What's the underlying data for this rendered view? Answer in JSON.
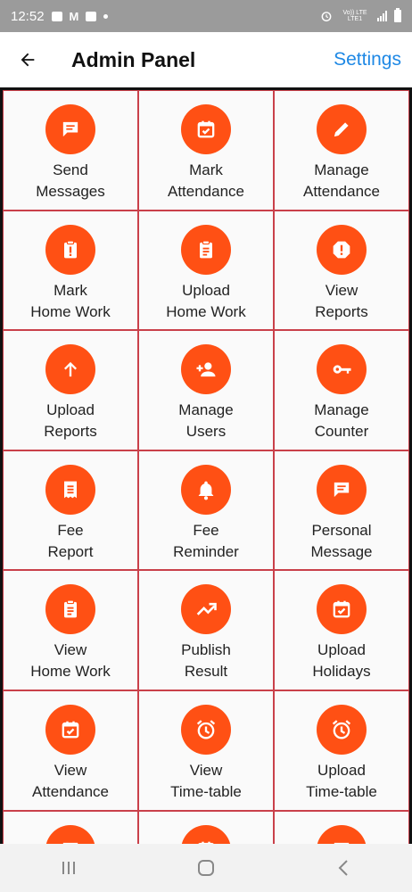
{
  "status_bar": {
    "time": "12:52",
    "network": "Vo)) LTE LTE1"
  },
  "app_bar": {
    "title": "Admin Panel",
    "settings_label": "Settings"
  },
  "colors": {
    "accent": "#ff5014",
    "tile_border": "#c9404a",
    "link": "#1e88e5"
  },
  "tiles": [
    {
      "line1": "Send",
      "line2": "Messages",
      "icon": "message-icon"
    },
    {
      "line1": "Mark",
      "line2": "Attendance",
      "icon": "calendar-check-icon"
    },
    {
      "line1": "Manage",
      "line2": "Attendance",
      "icon": "pencil-icon"
    },
    {
      "line1": "Mark",
      "line2": "Home Work",
      "icon": "clipboard-alert-icon"
    },
    {
      "line1": "Upload",
      "line2": "Home Work",
      "icon": "clipboard-list-icon"
    },
    {
      "line1": "View",
      "line2": "Reports",
      "icon": "report-alert-icon"
    },
    {
      "line1": "Upload",
      "line2": "Reports",
      "icon": "arrow-up-icon"
    },
    {
      "line1": "Manage",
      "line2": "Users",
      "icon": "add-user-icon"
    },
    {
      "line1": "Manage",
      "line2": "Counter",
      "icon": "key-icon"
    },
    {
      "line1": "Fee",
      "line2": "Report",
      "icon": "receipt-icon"
    },
    {
      "line1": "Fee",
      "line2": "Reminder",
      "icon": "bell-icon"
    },
    {
      "line1": "Personal",
      "line2": "Message",
      "icon": "message-icon"
    },
    {
      "line1": "View",
      "line2": "Home Work",
      "icon": "clipboard-list-icon"
    },
    {
      "line1": "Publish",
      "line2": "Result",
      "icon": "trending-up-icon"
    },
    {
      "line1": "Upload",
      "line2": "Holidays",
      "icon": "calendar-check-icon"
    },
    {
      "line1": "View",
      "line2": "Attendance",
      "icon": "calendar-check-icon"
    },
    {
      "line1": "View",
      "line2": "Time-table",
      "icon": "alarm-icon"
    },
    {
      "line1": "Upload",
      "line2": "Time-table",
      "icon": "alarm-icon"
    },
    {
      "line1": "",
      "line2": "",
      "icon": "message-icon"
    },
    {
      "line1": "",
      "line2": "",
      "icon": "calendar-check-icon"
    },
    {
      "line1": "",
      "line2": "",
      "icon": "message-icon"
    }
  ]
}
